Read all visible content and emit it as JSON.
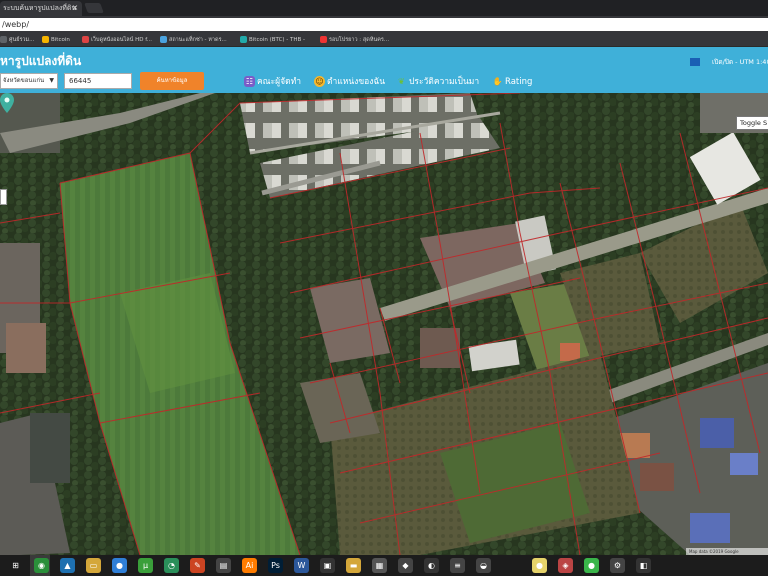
{
  "browser": {
    "tab_title": "ระบบค้นหารูปแปลงที่ดิน",
    "tab_close": "×",
    "url": "/webp/",
    "bookmarks": [
      {
        "label": "ศูนย์รวม...",
        "color": "#5f6368"
      },
      {
        "label": "Bitcoin",
        "color": "#f7b500"
      },
      {
        "label": "เว็บดูหนังออนไลน์ HD f...",
        "color": "#d44"
      },
      {
        "label": "สถานะแท็กซ่า - หาดร...",
        "color": "#4aa3df"
      },
      {
        "label": "Bitcoin (BTC) - THB -",
        "color": "#2aa"
      },
      {
        "label": "รอบโปรยาว : สุดหินคร...",
        "color": "#e33"
      }
    ]
  },
  "header": {
    "title": "หารูปแปลงที่ดิน",
    "province_select": "จังหวัดขอนแก่น",
    "parcel_number": "66445",
    "search_button": "ค้นหาข้อมูล",
    "menu": [
      {
        "label": "คณะผู้จัดทำ",
        "icon": "team-icon",
        "color": "#7a5cc7"
      },
      {
        "label": "ตำแหน่งของฉัน",
        "icon": "location-icon",
        "color": "#f5b82e"
      },
      {
        "label": "ประวัติความเป็นมา",
        "icon": "history-icon",
        "color": "#6bbf3a"
      },
      {
        "label": "Rating",
        "icon": "rating-icon",
        "color": "#f5b82e"
      }
    ],
    "utm_label": "เปิด/ปิด - UTM 1:4000"
  },
  "map": {
    "toggle_tooltip": "Toggle S",
    "scale_text": "Map data ©2019 Google",
    "marker_color": "#3fb0a0"
  },
  "taskbar": {
    "icons": [
      {
        "name": "windows-icon",
        "glyph": "⊞",
        "color": "#1c1c1c"
      },
      {
        "name": "chrome-icon",
        "glyph": "◉",
        "color": "#2a8f3a"
      },
      {
        "name": "mountain-app-icon",
        "glyph": "▲",
        "color": "#1e70b0"
      },
      {
        "name": "file-explorer-icon",
        "glyph": "▭",
        "color": "#d4a73a"
      },
      {
        "name": "firefox-icon",
        "glyph": "●",
        "color": "#2f7fd8"
      },
      {
        "name": "utorrent-icon",
        "glyph": "µ",
        "color": "#3a9f3a"
      },
      {
        "name": "speedtest-icon",
        "glyph": "◔",
        "color": "#2a8f5a"
      },
      {
        "name": "paint-icon",
        "glyph": "✎",
        "color": "#cc4422"
      },
      {
        "name": "media-icon",
        "glyph": "▤",
        "color": "#444"
      },
      {
        "name": "illustrator-icon",
        "glyph": "Ai",
        "color": "#ff7c00"
      },
      {
        "name": "photoshop-icon",
        "glyph": "Ps",
        "color": "#001e36"
      },
      {
        "name": "word-icon",
        "glyph": "W",
        "color": "#2b579a"
      },
      {
        "name": "terminal-icon",
        "glyph": "▣",
        "color": "#333"
      },
      {
        "name": "folder-icon",
        "glyph": "▬",
        "color": "#d4a73a"
      },
      {
        "name": "calculator-icon",
        "glyph": "▦",
        "color": "#555"
      },
      {
        "name": "network-icon",
        "glyph": "◆",
        "color": "#444"
      },
      {
        "name": "app-icon-a",
        "glyph": "◐",
        "color": "#333"
      },
      {
        "name": "app-icon-b",
        "glyph": "≡",
        "color": "#444"
      },
      {
        "name": "app-icon-c",
        "glyph": "◒",
        "color": "#444"
      },
      {
        "name": "notes-icon",
        "glyph": "●",
        "color": "#e6d36a"
      },
      {
        "name": "game-icon",
        "glyph": "◈",
        "color": "#b44"
      },
      {
        "name": "line-icon",
        "glyph": "●",
        "color": "#3ab54a"
      },
      {
        "name": "settings-icon",
        "glyph": "⚙",
        "color": "#444"
      },
      {
        "name": "store-icon",
        "glyph": "◧",
        "color": "#333"
      }
    ]
  }
}
